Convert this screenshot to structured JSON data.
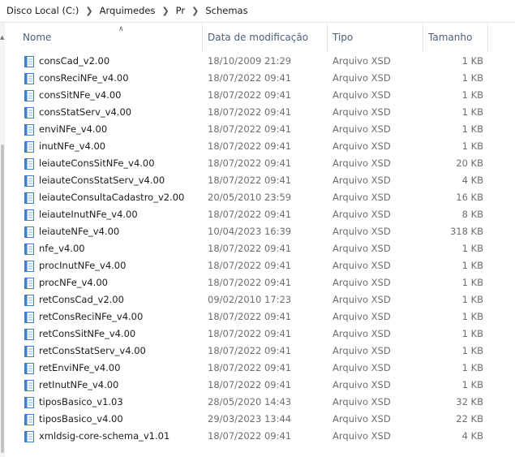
{
  "breadcrumb": [
    "Disco Local (C:)",
    "Arquimedes",
    "Pr",
    "Schemas"
  ],
  "columns": {
    "name": "Nome",
    "date": "Data de modificação",
    "type": "Tipo",
    "size": "Tamanho"
  },
  "files": [
    {
      "name": "consCad_v2.00",
      "date": "18/10/2009 21:29",
      "type": "Arquivo XSD",
      "size": "1 KB"
    },
    {
      "name": "consReciNFe_v4.00",
      "date": "18/07/2022 09:41",
      "type": "Arquivo XSD",
      "size": "1 KB"
    },
    {
      "name": "consSitNFe_v4.00",
      "date": "18/07/2022 09:41",
      "type": "Arquivo XSD",
      "size": "1 KB"
    },
    {
      "name": "consStatServ_v4.00",
      "date": "18/07/2022 09:41",
      "type": "Arquivo XSD",
      "size": "1 KB"
    },
    {
      "name": "enviNFe_v4.00",
      "date": "18/07/2022 09:41",
      "type": "Arquivo XSD",
      "size": "1 KB"
    },
    {
      "name": "inutNFe_v4.00",
      "date": "18/07/2022 09:41",
      "type": "Arquivo XSD",
      "size": "1 KB"
    },
    {
      "name": "leiauteConsSitNFe_v4.00",
      "date": "18/07/2022 09:41",
      "type": "Arquivo XSD",
      "size": "20 KB"
    },
    {
      "name": "leiauteConsStatServ_v4.00",
      "date": "18/07/2022 09:41",
      "type": "Arquivo XSD",
      "size": "4 KB"
    },
    {
      "name": "leiauteConsultaCadastro_v2.00",
      "date": "20/05/2010 23:59",
      "type": "Arquivo XSD",
      "size": "16 KB"
    },
    {
      "name": "leiauteInutNFe_v4.00",
      "date": "18/07/2022 09:41",
      "type": "Arquivo XSD",
      "size": "8 KB"
    },
    {
      "name": "leiauteNFe_v4.00",
      "date": "10/04/2023 16:39",
      "type": "Arquivo XSD",
      "size": "318 KB"
    },
    {
      "name": "nfe_v4.00",
      "date": "18/07/2022 09:41",
      "type": "Arquivo XSD",
      "size": "1 KB"
    },
    {
      "name": "procInutNFe_v4.00",
      "date": "18/07/2022 09:41",
      "type": "Arquivo XSD",
      "size": "1 KB"
    },
    {
      "name": "procNFe_v4.00",
      "date": "18/07/2022 09:41",
      "type": "Arquivo XSD",
      "size": "1 KB"
    },
    {
      "name": "retConsCad_v2.00",
      "date": "09/02/2010 17:23",
      "type": "Arquivo XSD",
      "size": "1 KB"
    },
    {
      "name": "retConsReciNFe_v4.00",
      "date": "18/07/2022 09:41",
      "type": "Arquivo XSD",
      "size": "1 KB"
    },
    {
      "name": "retConsSitNFe_v4.00",
      "date": "18/07/2022 09:41",
      "type": "Arquivo XSD",
      "size": "1 KB"
    },
    {
      "name": "retConsStatServ_v4.00",
      "date": "18/07/2022 09:41",
      "type": "Arquivo XSD",
      "size": "1 KB"
    },
    {
      "name": "retEnviNFe_v4.00",
      "date": "18/07/2022 09:41",
      "type": "Arquivo XSD",
      "size": "1 KB"
    },
    {
      "name": "retInutNFe_v4.00",
      "date": "18/07/2022 09:41",
      "type": "Arquivo XSD",
      "size": "1 KB"
    },
    {
      "name": "tiposBasico_v1.03",
      "date": "28/05/2020 14:43",
      "type": "Arquivo XSD",
      "size": "32 KB"
    },
    {
      "name": "tiposBasico_v4.00",
      "date": "29/03/2023 13:44",
      "type": "Arquivo XSD",
      "size": "22 KB"
    },
    {
      "name": "xmldsig-core-schema_v1.01",
      "date": "18/07/2022 09:41",
      "type": "Arquivo XSD",
      "size": "4 KB"
    }
  ],
  "icons": {
    "file": "xsd-file-icon",
    "separator": "chevron-right-icon",
    "sort": "sort-ascending-icon"
  },
  "colors": {
    "header_text": "#4c607a",
    "meta_text": "#6d6d6d",
    "icon_blue": "#3d7fc8"
  }
}
